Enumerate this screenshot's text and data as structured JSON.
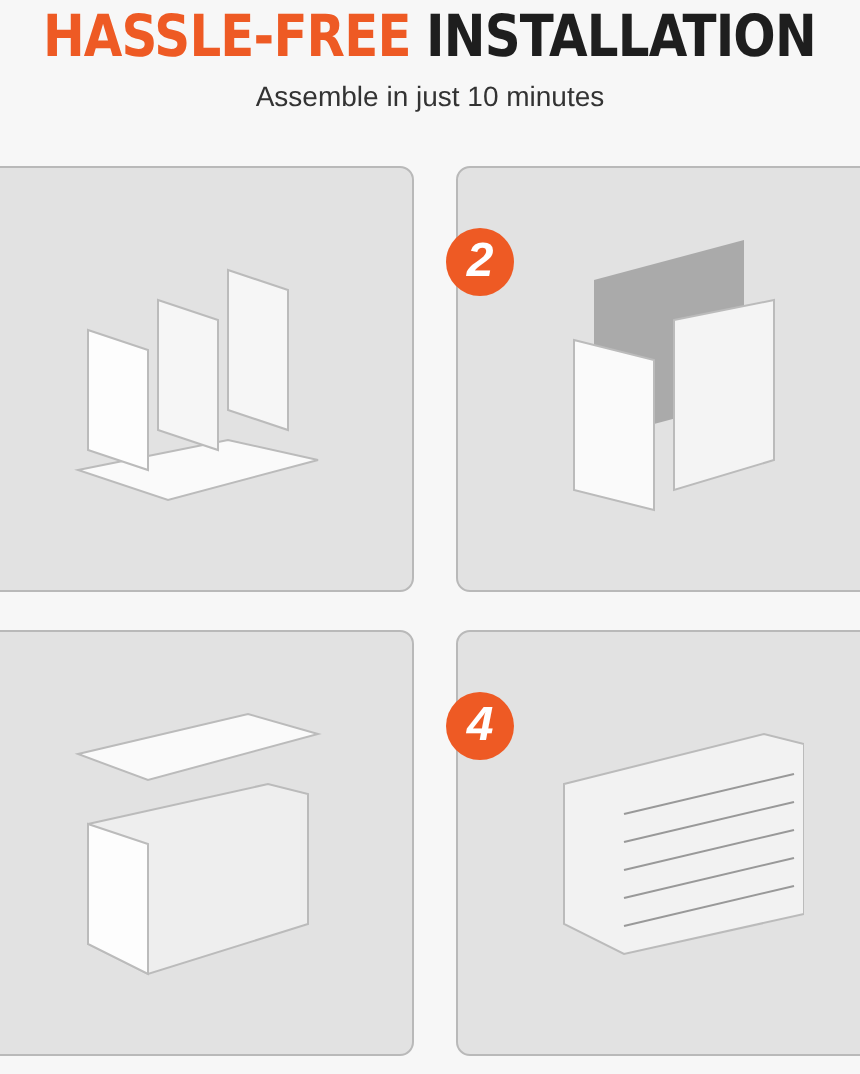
{
  "heading": {
    "accent": "HASSLE-FREE",
    "rest": "INSTALLATION"
  },
  "subtitle": "Assemble in just 10 minutes",
  "steps": [
    {
      "kind": "panels"
    },
    {
      "kind": "dividers",
      "badge": "2"
    },
    {
      "kind": "top"
    },
    {
      "kind": "finished",
      "badge": "4"
    }
  ]
}
